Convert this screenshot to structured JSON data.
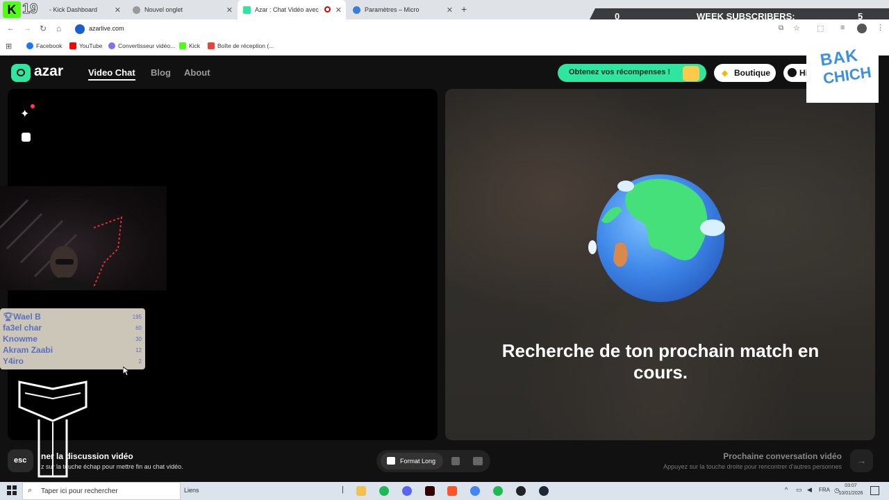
{
  "browser": {
    "tabs": [
      {
        "label": "- Kick Dashboard"
      },
      {
        "label": "Nouvel onglet"
      },
      {
        "label": "Azar : Chat Vidéo avec de"
      },
      {
        "label": "Paramètres – Micro"
      }
    ],
    "address": "azarlive.com",
    "bookmarks": [
      "Facebook",
      "YouTube",
      "Convertisseur vidéo...",
      "Kick",
      "Boîte de réception (..."
    ]
  },
  "overlay": {
    "counter": "19",
    "subs_left_value": "0",
    "subs_label": "WEEK SUBSCRIBERS:",
    "subs_right_value": "5",
    "logo_line1": "BAK",
    "logo_line2": "CHICH",
    "leaderboard": [
      {
        "name": "Wael B",
        "score": "195"
      },
      {
        "name": "fa3el char",
        "score": "60"
      },
      {
        "name": "Knowme",
        "score": "30"
      },
      {
        "name": "Akram Zaabi",
        "score": "12"
      },
      {
        "name": "Y4iro",
        "score": "2"
      }
    ]
  },
  "site": {
    "logo": "azar",
    "nav": [
      "Video Chat",
      "Blog",
      "About"
    ],
    "rewards_button": "Obtenez vos récompenses !",
    "shop_button": "Boutique",
    "history_button": "Hi",
    "search_text": "Recherche de ton prochain match en cours.",
    "esc_key": "esc",
    "end_title": "ner la discussion vidéo",
    "end_sub": "z sur la touche échap pour mettre fin au chat vidéo.",
    "format_label": "Format Long",
    "next_title": "Prochaine conversation vidéo",
    "next_sub": "Appuyez sur la touche droite pour rencontrer d'autres personnes"
  },
  "taskbar": {
    "search_placeholder": "Taper ici pour rechercher",
    "links": "Liens",
    "lang": "FRA",
    "time": "03:07",
    "date": "10/01/2026"
  },
  "colors": {
    "accent_green": "#2ee6a0",
    "kick_green": "#53fc18",
    "leaderboard_text": "#5b6fc0"
  }
}
